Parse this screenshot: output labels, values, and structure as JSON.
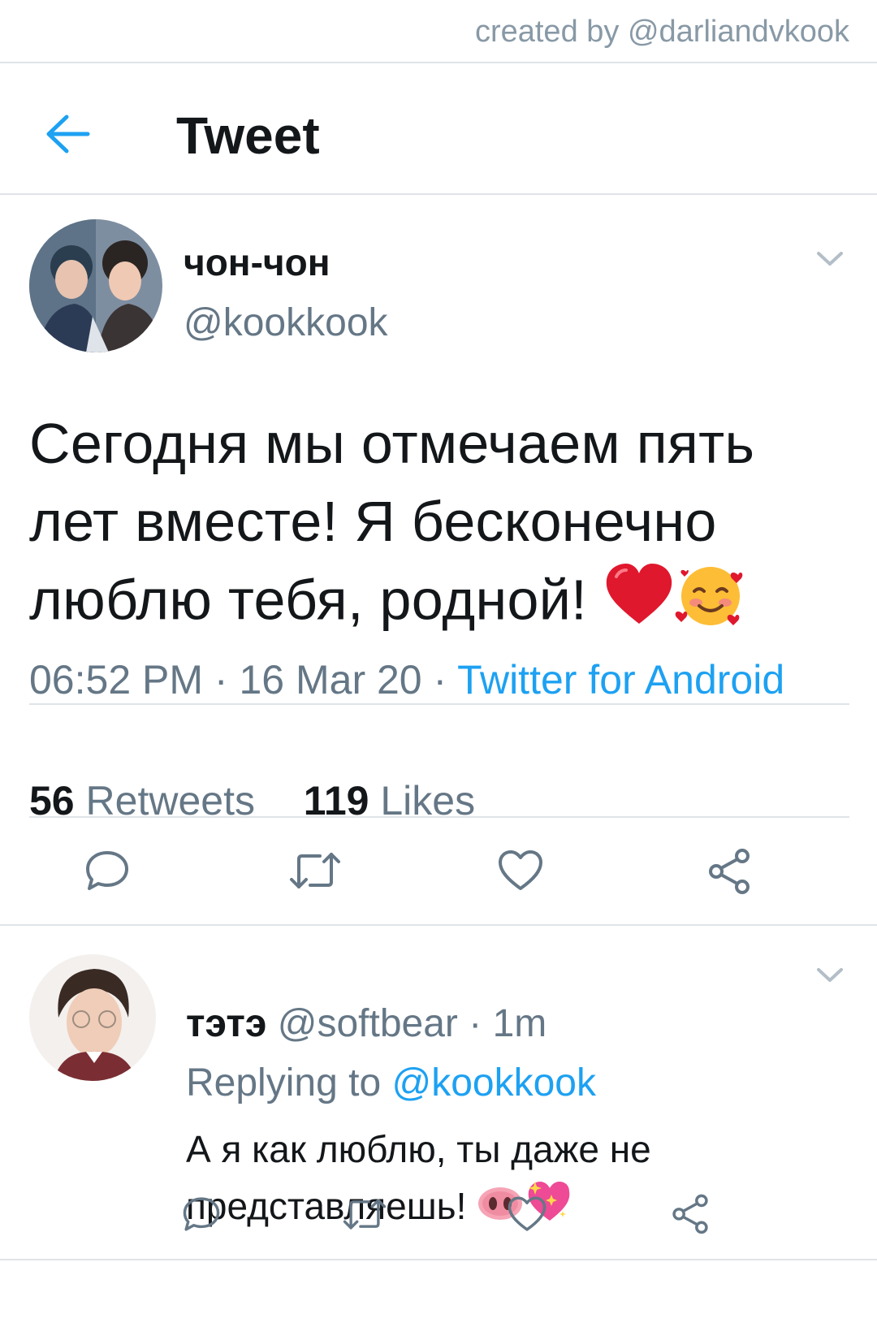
{
  "credit": "created by @darliandvkook",
  "header": {
    "title": "Tweet",
    "back_icon": "arrow-left-icon"
  },
  "tweet": {
    "author_name": "чон-чон",
    "author_handle": "@kookkook",
    "text": "Сегодня мы отмечаем пять лет вместе! Я бесконечно люблю тебя, родной!",
    "emojis": [
      "red-heart-emoji",
      "smiling-face-with-hearts-emoji"
    ],
    "time": "06:52 PM",
    "date": "16 Mar 20",
    "separator": "·",
    "source": "Twitter for Android",
    "retweets_count": "56",
    "retweets_label": "Retweets",
    "likes_count": "119",
    "likes_label": "Likes",
    "actions": [
      "reply-icon",
      "retweet-icon",
      "like-icon",
      "share-icon"
    ]
  },
  "reply": {
    "author_name": "тэтэ",
    "author_handle": "@softbear",
    "time": "1m",
    "separator": "·",
    "replying_prefix": "Replying to",
    "replying_handle": "@kookkook",
    "text": "А я как люблю, ты даже не представляешь!",
    "emojis": [
      "pig-nose-emoji",
      "sparkling-heart-emoji"
    ],
    "actions": [
      "reply-icon",
      "retweet-icon",
      "like-icon",
      "share-icon"
    ]
  },
  "colors": {
    "accent": "#1da1f2",
    "muted": "#657786",
    "divider": "#dfe4e8",
    "text": "#14171a"
  }
}
